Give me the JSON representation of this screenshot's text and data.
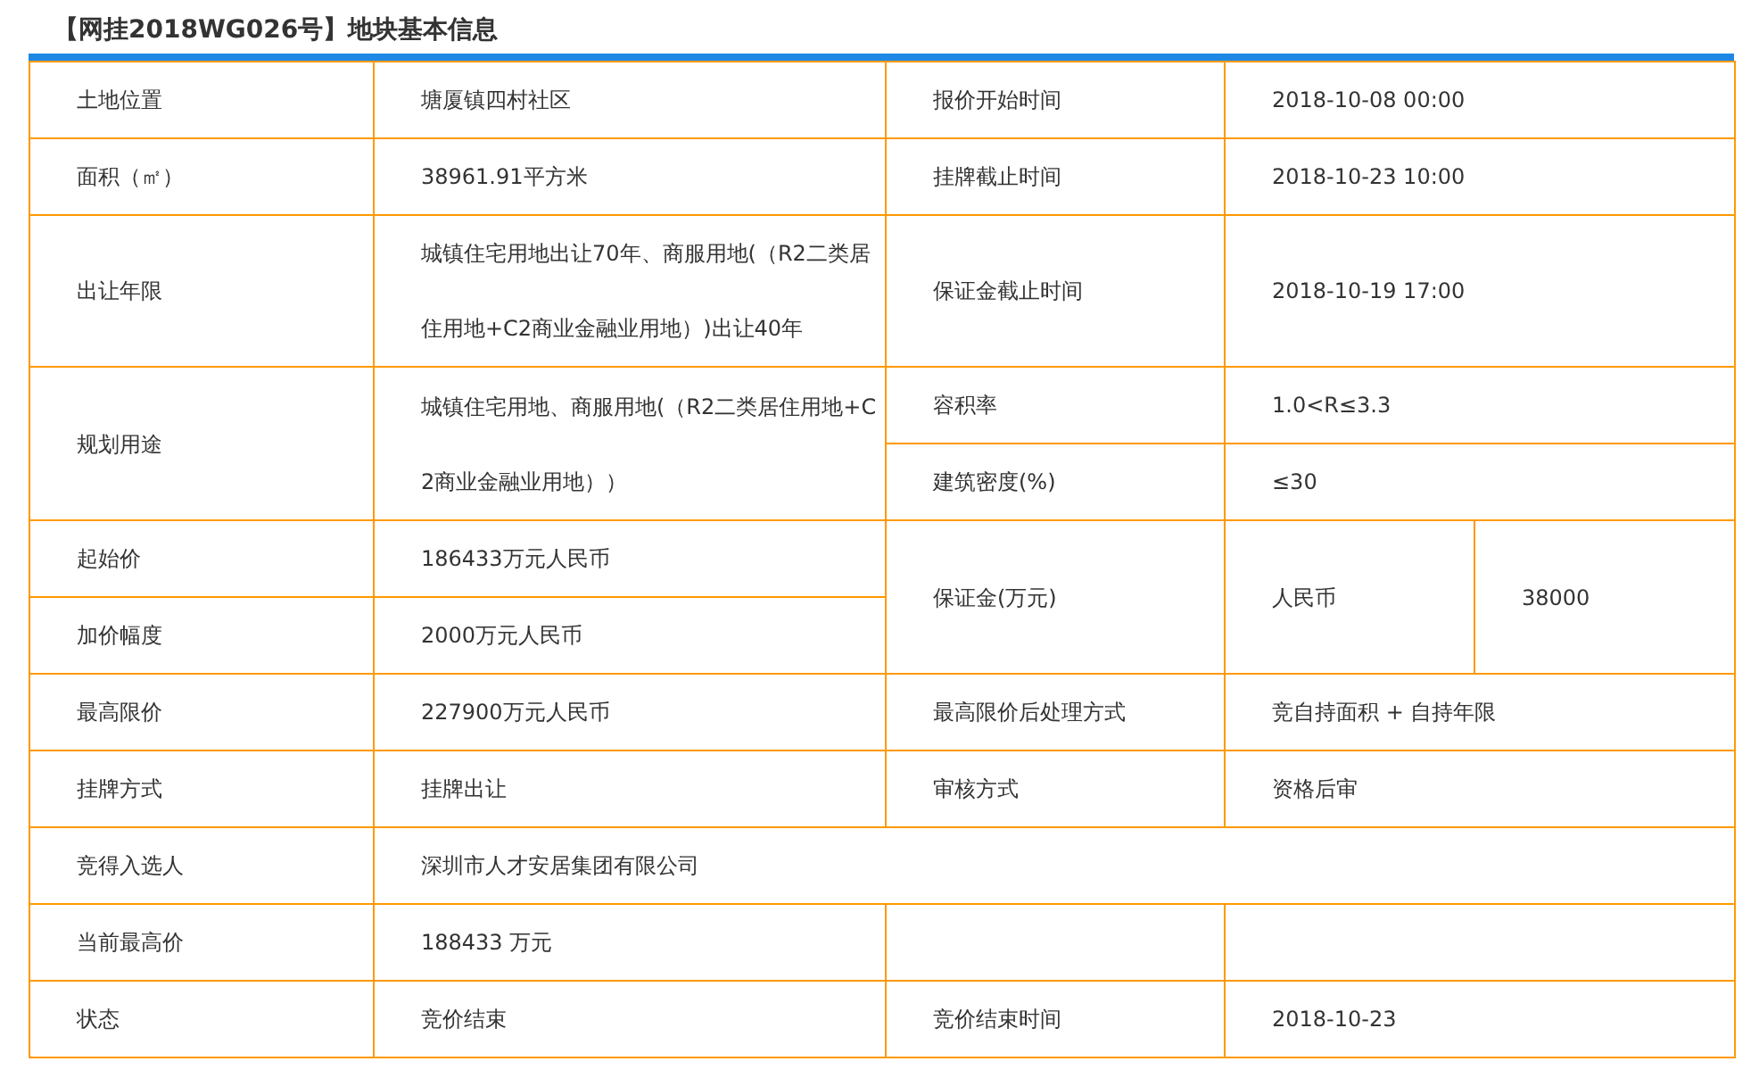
{
  "title": "【网挂2018WG026号】地块基本信息",
  "rows": [
    {
      "cells": [
        {
          "kind": "label",
          "text": "土地位置"
        },
        {
          "kind": "value",
          "text": "塘厦镇四村社区"
        },
        {
          "kind": "label",
          "text": "报价开始时间"
        },
        {
          "kind": "value",
          "text": "2018-10-08 00:00"
        }
      ]
    },
    {
      "cells": [
        {
          "kind": "label",
          "text": "面积（㎡）"
        },
        {
          "kind": "value",
          "text": "38961.91平方米"
        },
        {
          "kind": "label",
          "text": "挂牌截止时间"
        },
        {
          "kind": "value",
          "text": "2018-10-23 10:00"
        }
      ]
    },
    {
      "cells": [
        {
          "kind": "label",
          "text": "出让年限"
        },
        {
          "kind": "value",
          "text": "城镇住宅用地出让70年、商服用地(（R2二类居住用地+C2商业金融业用地）)出让40年"
        },
        {
          "kind": "label",
          "text": "保证金截止时间"
        },
        {
          "kind": "value",
          "text": "2018-10-19 17:00"
        }
      ]
    },
    {
      "cells": [
        {
          "kind": "label",
          "text": "规划用途",
          "rowspan": 2
        },
        {
          "kind": "value",
          "text": "城镇住宅用地、商服用地(（R2二类居住用地+C2商业金融业用地））",
          "rowspan": 2
        },
        {
          "kind": "label",
          "text": "容积率"
        },
        {
          "kind": "value",
          "text": "1.0<R≤3.3"
        }
      ]
    },
    {
      "cells": [
        {
          "kind": "label",
          "text": "建筑密度(%)"
        },
        {
          "kind": "value",
          "text": "≤30"
        }
      ]
    },
    {
      "cells": [
        {
          "kind": "label",
          "text": "起始价"
        },
        {
          "kind": "value",
          "text": "186433万元人民币"
        },
        {
          "kind": "label",
          "text": "保证金(万元)",
          "rowspan": 2
        },
        {
          "kind": "pair",
          "parts": [
            "人民币",
            "38000"
          ],
          "rowspan": 2
        }
      ]
    },
    {
      "cells": [
        {
          "kind": "label",
          "text": "加价幅度"
        },
        {
          "kind": "value",
          "text": "2000万元人民币"
        }
      ]
    },
    {
      "cells": [
        {
          "kind": "label",
          "text": "最高限价"
        },
        {
          "kind": "value",
          "text": "227900万元人民币"
        },
        {
          "kind": "label",
          "text": "最高限价后处理方式"
        },
        {
          "kind": "value",
          "text": "竞自持面积 + 自持年限"
        }
      ]
    },
    {
      "cells": [
        {
          "kind": "label",
          "text": "挂牌方式"
        },
        {
          "kind": "value",
          "text": "挂牌出让"
        },
        {
          "kind": "label",
          "text": "审核方式"
        },
        {
          "kind": "value",
          "text": "资格后审"
        }
      ]
    },
    {
      "cells": [
        {
          "kind": "label",
          "text": "竞得入选人"
        },
        {
          "kind": "value",
          "text": "深圳市人才安居集团有限公司",
          "colspan": 3
        }
      ]
    },
    {
      "cells": [
        {
          "kind": "label",
          "text": "当前最高价"
        },
        {
          "kind": "value",
          "text": "188433 万元"
        },
        {
          "kind": "empty"
        },
        {
          "kind": "empty"
        }
      ]
    },
    {
      "cells": [
        {
          "kind": "label",
          "text": "状态"
        },
        {
          "kind": "value",
          "text": "竞价结束"
        },
        {
          "kind": "label",
          "text": "竞价结束时间"
        },
        {
          "kind": "value",
          "text": "2018-10-23"
        }
      ]
    }
  ]
}
